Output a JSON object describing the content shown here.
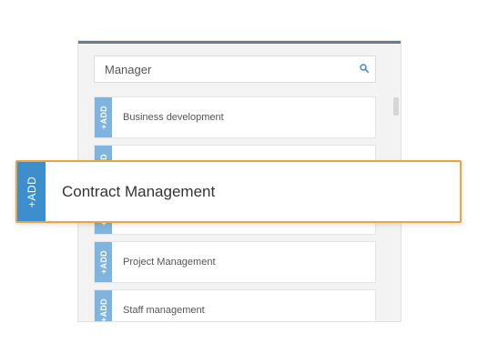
{
  "search": {
    "value": "Manager",
    "icon": "search-icon"
  },
  "list": {
    "add_label": "+ADD",
    "items": [
      {
        "label": "Business development"
      },
      {
        "label": ""
      },
      {
        "label": ""
      },
      {
        "label": "Project Management"
      },
      {
        "label": "Staff management"
      }
    ]
  },
  "highlight": {
    "add_label": "+ADD",
    "label": "Contract Management"
  },
  "colors": {
    "tab_light": "#7fb4de",
    "tab_dark": "#3c8fcc",
    "highlight_border": "#f0a33d",
    "panel_top_border": "#6f7a86"
  }
}
